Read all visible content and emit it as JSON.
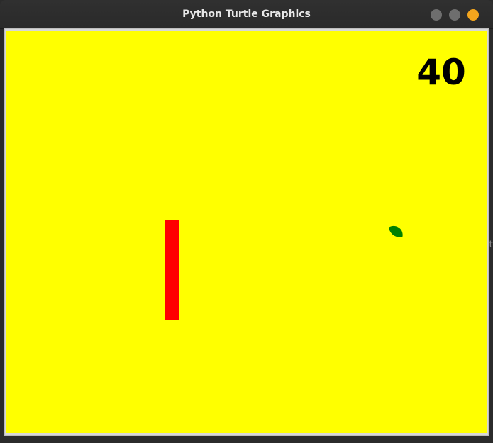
{
  "window": {
    "title": "Python Turtle Graphics"
  },
  "game": {
    "score": "40",
    "background_color": "#ffff00",
    "paddle_color": "#ff0000",
    "ball_color": "#008000",
    "ball_shape": "turtle-icon"
  },
  "titlebar_buttons": {
    "minimize_color": "#6e6e6e",
    "maximize_color": "#6e6e6e",
    "close_color": "#f3a51d"
  }
}
